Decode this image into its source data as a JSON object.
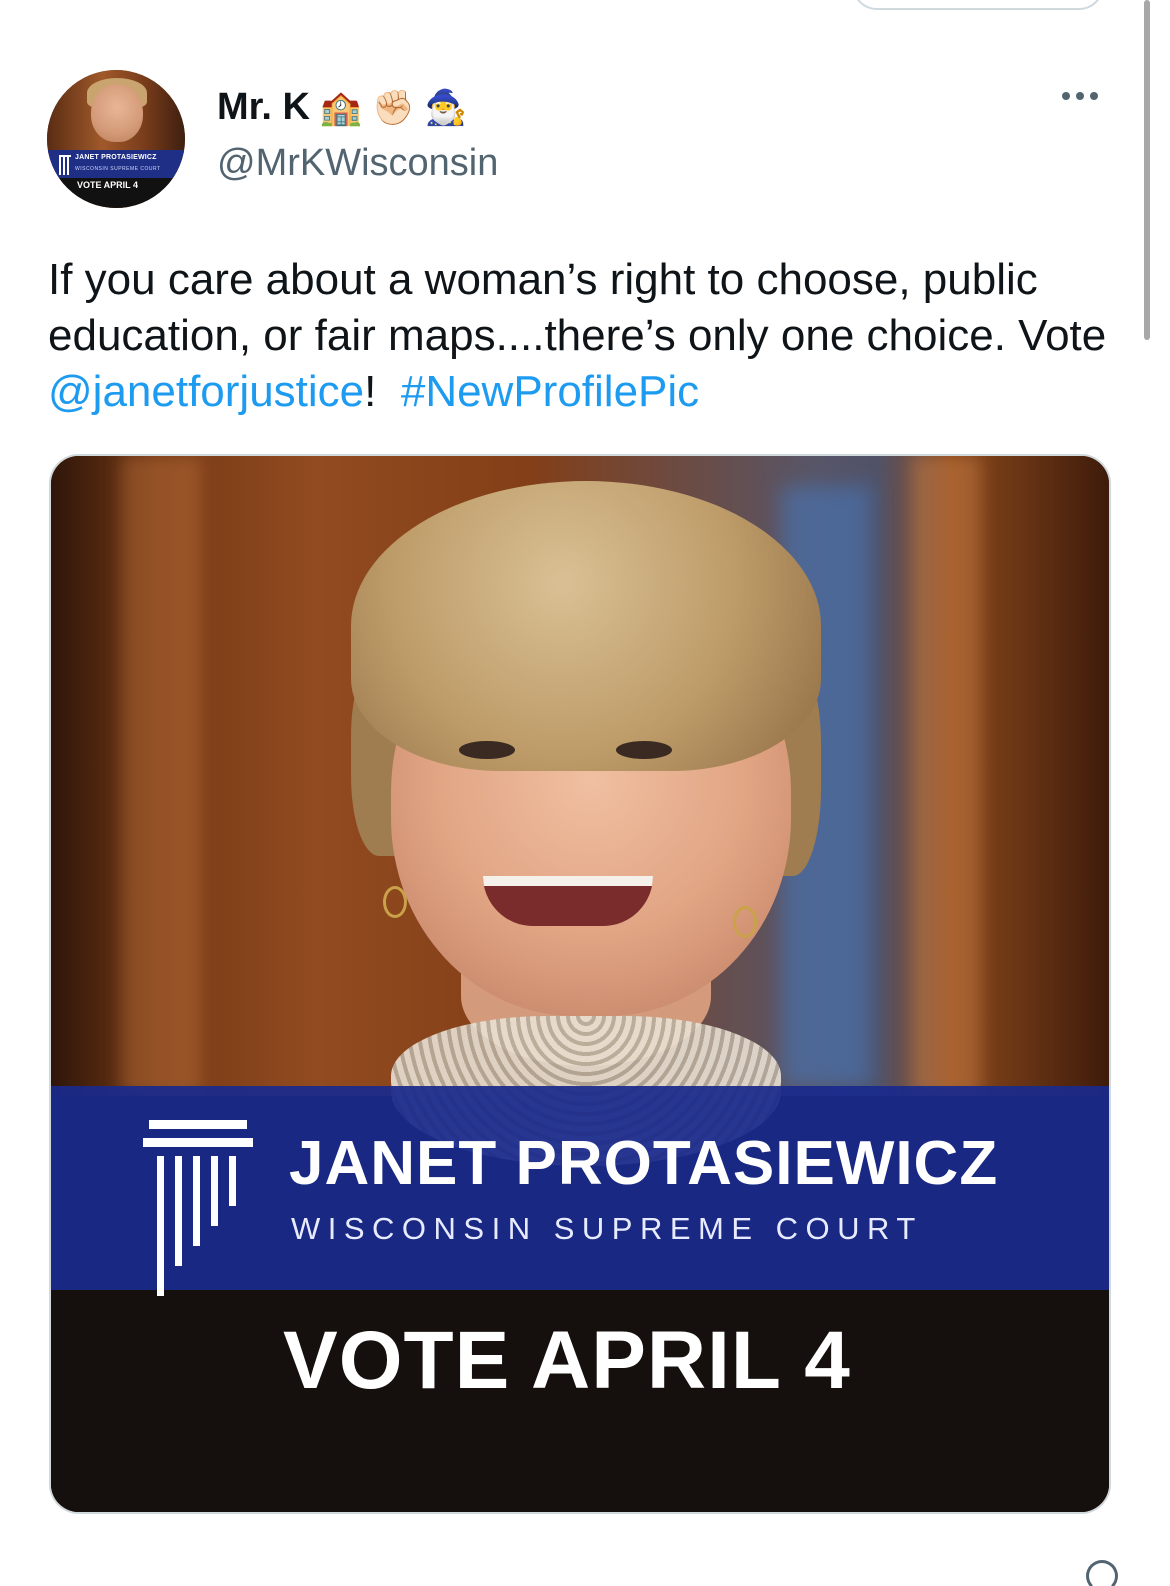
{
  "author": {
    "display_name": "Mr. K",
    "badges": [
      "🏫",
      "✊🏻",
      "🧙‍♂️"
    ],
    "handle": "@MrKWisconsin",
    "avatar": {
      "band_title": "JANET PROTASIEWICZ",
      "band_subtitle": "WISCONSIN SUPREME COURT",
      "footer": "VOTE APRIL 4"
    }
  },
  "tweet": {
    "text_before": "If you care about a woman’s right to choose, public education, or fair maps....there’s only one choice. Vote ",
    "mention": "@janetforjustice",
    "text_between": "!  ",
    "hashtag": "#NewProfilePic"
  },
  "media": {
    "name": "JANET PROTASIEWICZ",
    "subtitle": "WISCONSIN SUPREME COURT",
    "vote_line": "VOTE APRIL 4"
  },
  "icons": {
    "more": "more-icon",
    "logo": "pillar-logo-icon"
  },
  "colors": {
    "link": "#1d9bf0",
    "banner": "#1a2a8c",
    "secondary_text": "#536471"
  }
}
